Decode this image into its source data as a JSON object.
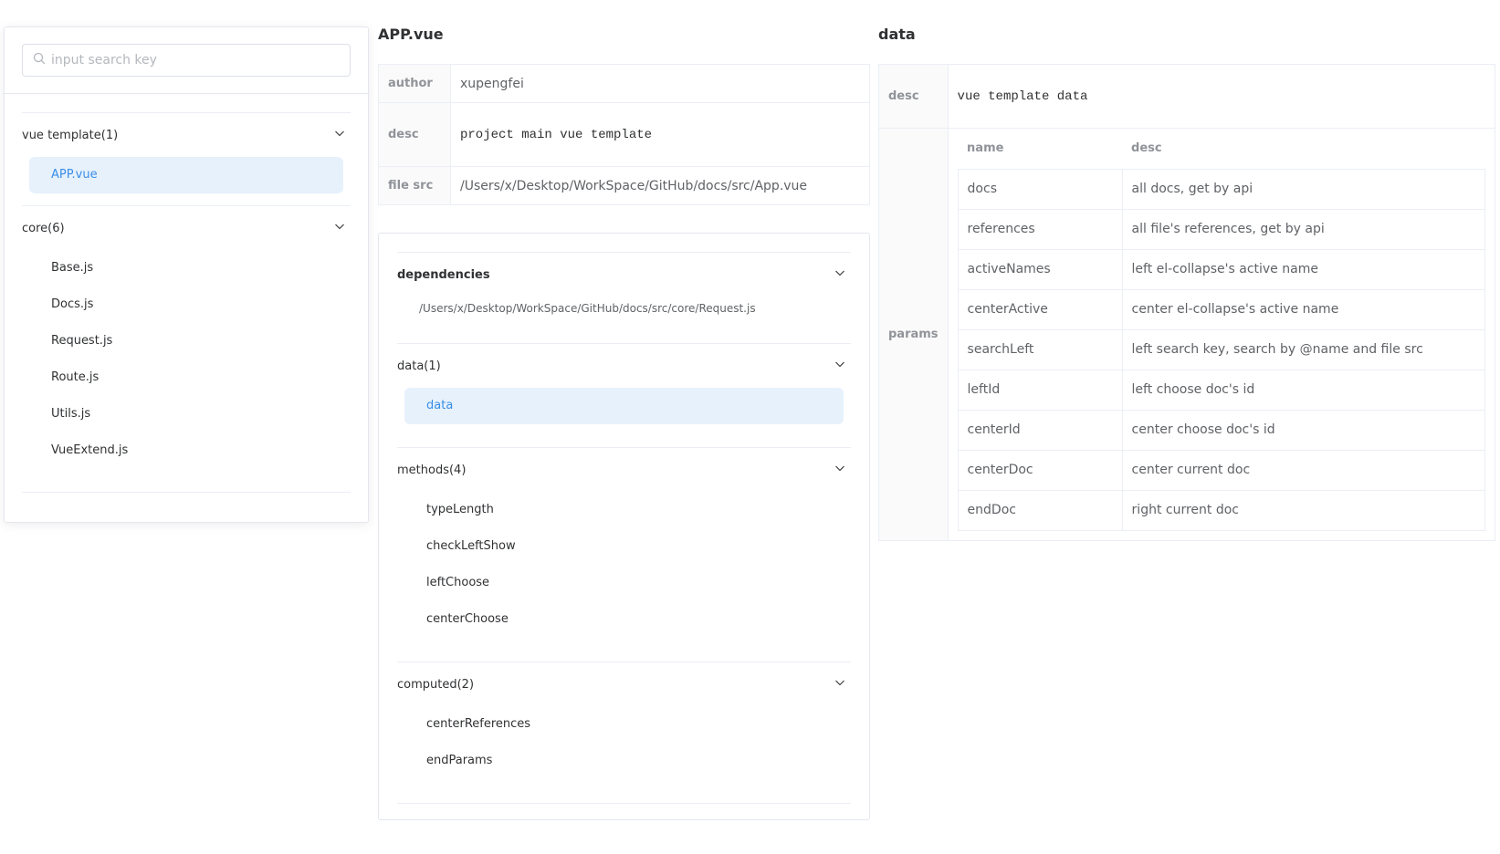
{
  "left": {
    "search": {
      "placeholder": "input search key",
      "value": ""
    },
    "groups": [
      {
        "title": "vue template(1)",
        "items": [
          "APP.vue"
        ],
        "active": "APP.vue"
      },
      {
        "title": "core(6)",
        "items": [
          "Base.js",
          "Docs.js",
          "Request.js",
          "Route.js",
          "Utils.js",
          "VueExtend.js"
        ]
      }
    ]
  },
  "center": {
    "title": "APP.vue",
    "info": {
      "author_label": "author",
      "author": "xupengfei",
      "desc_label": "desc",
      "desc": "project main vue template",
      "src_label": "file src",
      "src": "/Users/x/Desktop/WorkSpace/GitHub/docs/src/App.vue"
    },
    "sections": {
      "dependencies": {
        "title": "dependencies",
        "items": [
          "/Users/x/Desktop/WorkSpace/GitHub/docs/src/core/Request.js"
        ]
      },
      "data": {
        "title": "data(1)",
        "items": [
          "data"
        ]
      },
      "methods": {
        "title": "methods(4)",
        "items": [
          "typeLength",
          "checkLeftShow",
          "leftChoose",
          "centerChoose"
        ]
      },
      "computed": {
        "title": "computed(2)",
        "items": [
          "centerReferences",
          "endParams"
        ]
      }
    }
  },
  "right": {
    "title": "data",
    "desc_label": "desc",
    "desc": "vue template data",
    "params_label": "params",
    "columns": [
      "name",
      "desc"
    ],
    "rows": [
      [
        "docs",
        "all docs, get by api"
      ],
      [
        "references",
        "all file's references, get by api"
      ],
      [
        "activeNames",
        "left el-collapse's active name"
      ],
      [
        "centerActive",
        "center el-collapse's active name"
      ],
      [
        "searchLeft",
        "left search key, search by @name and file src"
      ],
      [
        "leftId",
        "left choose doc's id"
      ],
      [
        "centerId",
        "center choose doc's id"
      ],
      [
        "centerDoc",
        "center current doc"
      ],
      [
        "endDoc",
        "right current doc"
      ]
    ]
  },
  "icons": {
    "search": "search-icon",
    "chevron": "chevron-down-icon"
  },
  "colors": {
    "accent": "#3a8ee6",
    "active_bg": "#e6f1fc",
    "border": "#ebeef5",
    "label_bg": "#fafafa"
  }
}
